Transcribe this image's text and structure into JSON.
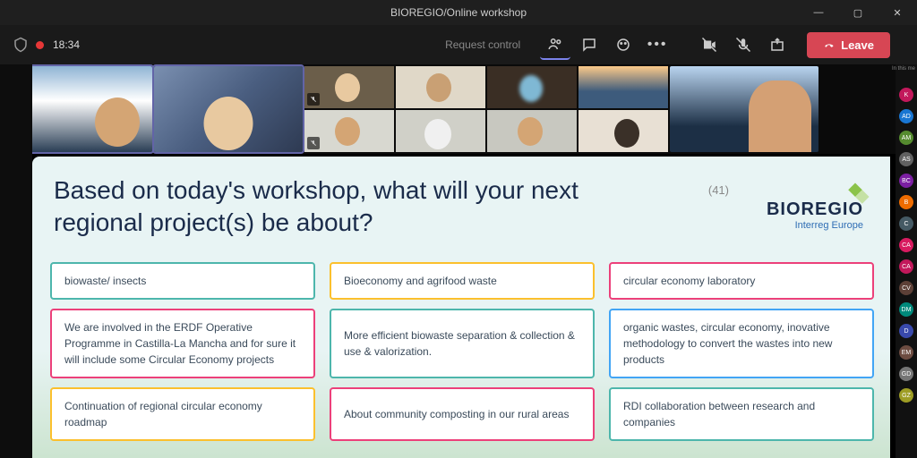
{
  "titlebar": {
    "title": "BIOREGIO/Online workshop"
  },
  "toolbar": {
    "time": "18:34",
    "request_control": "Request control",
    "leave": "Leave"
  },
  "panel_label": "In this me",
  "avatars": [
    {
      "label": "K",
      "color": "#c2185b"
    },
    {
      "label": "AD",
      "color": "#1976d2"
    },
    {
      "label": "AM",
      "color": "#558b2f"
    },
    {
      "label": "AS",
      "color": "#616161"
    },
    {
      "label": "BC",
      "color": "#7b1fa2"
    },
    {
      "label": "B",
      "color": "#ef6c00"
    },
    {
      "label": "C",
      "color": "#455a64"
    },
    {
      "label": "CA",
      "color": "#d81b60"
    },
    {
      "label": "CA",
      "color": "#c2185b"
    },
    {
      "label": "CV",
      "color": "#5d4037"
    },
    {
      "label": "DM",
      "color": "#00897b"
    },
    {
      "label": "D",
      "color": "#3949ab"
    },
    {
      "label": "EM",
      "color": "#6d4c41"
    },
    {
      "label": "GD",
      "color": "#757575"
    },
    {
      "label": "GZ",
      "color": "#9e9d24"
    }
  ],
  "slide": {
    "heading": "Based on today's workshop, what will your next regional project(s) be about?",
    "count": "(41)",
    "brand": {
      "name": "BIOREGIO",
      "sub": "Interreg Europe"
    },
    "cards": [
      {
        "text": "biowaste/ insects",
        "cls": "c-teal"
      },
      {
        "text": "Bioeconomy and agrifood waste",
        "cls": "c-yellow"
      },
      {
        "text": "circular economy laboratory",
        "cls": "c-pink"
      },
      {
        "text": "We are involved in the ERDF Operative Programme in Castilla-La Mancha and for sure it will include some Circular Economy projects",
        "cls": "c-pink"
      },
      {
        "text": "More efficient biowaste separation & collection & use & valorization.",
        "cls": "c-teal"
      },
      {
        "text": "organic wastes, circular economy, inovative methodology to convert the wastes into new products",
        "cls": "c-blue"
      },
      {
        "text": "Continuation of regional circular economy roadmap",
        "cls": "c-yellow"
      },
      {
        "text": "About community composting in our rural areas",
        "cls": "c-pink"
      },
      {
        "text": "RDI collaboration between research and companies",
        "cls": "c-teal"
      }
    ]
  }
}
